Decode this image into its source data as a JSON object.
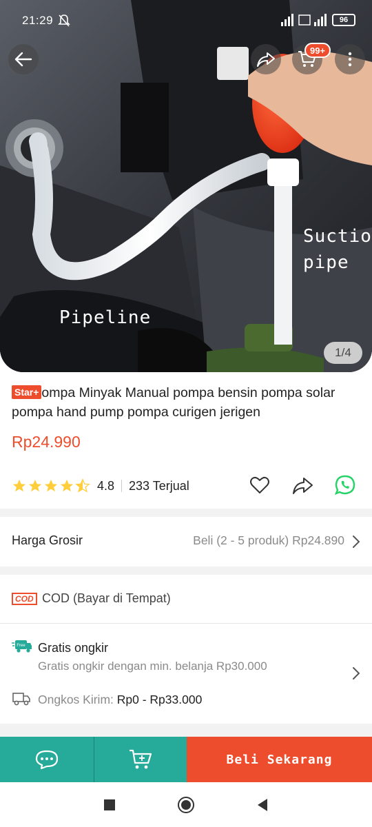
{
  "status": {
    "time": "21:29",
    "battery": "96",
    "icons": [
      "mute-bell-icon",
      "signal-icon",
      "wifi-icon",
      "battery-icon"
    ]
  },
  "header": {
    "cart_badge": "99+",
    "icons": [
      "back-arrow-icon",
      "share-icon",
      "cart-icon",
      "more-vertical-icon"
    ]
  },
  "image": {
    "counter": "1/4",
    "overlay_labels": {
      "suction": "Suction",
      "pipe": "pipe",
      "pipeline": "Pipeline"
    }
  },
  "product": {
    "badge": "Star+",
    "title": "ompa Minyak Manual pompa bensin pompa solar pompa hand pump pompa curigen jerigen",
    "price": "Rp24.990",
    "rating": "4.8",
    "sold": "233 Terjual",
    "stars_filled": 4.5
  },
  "wholesale": {
    "label": "Harga Grosir",
    "value": "Beli (2 - 5 produk) Rp24.890"
  },
  "cod": {
    "badge": "COD",
    "label": "COD (Bayar di Tempat)"
  },
  "shipping": {
    "free_badge": "Free",
    "title": "Gratis ongkir",
    "subtitle": "Gratis ongkir dengan min. belanja Rp30.000",
    "cost_label": "Ongkos Kirim:",
    "cost_value": "Rp0 - Rp33.000"
  },
  "bottom": {
    "buy_label": "Beli Sekarang"
  },
  "colors": {
    "accent": "#ee4d2d",
    "teal": "#26aa99",
    "star": "#ffce3d",
    "whatsapp": "#25d366"
  }
}
